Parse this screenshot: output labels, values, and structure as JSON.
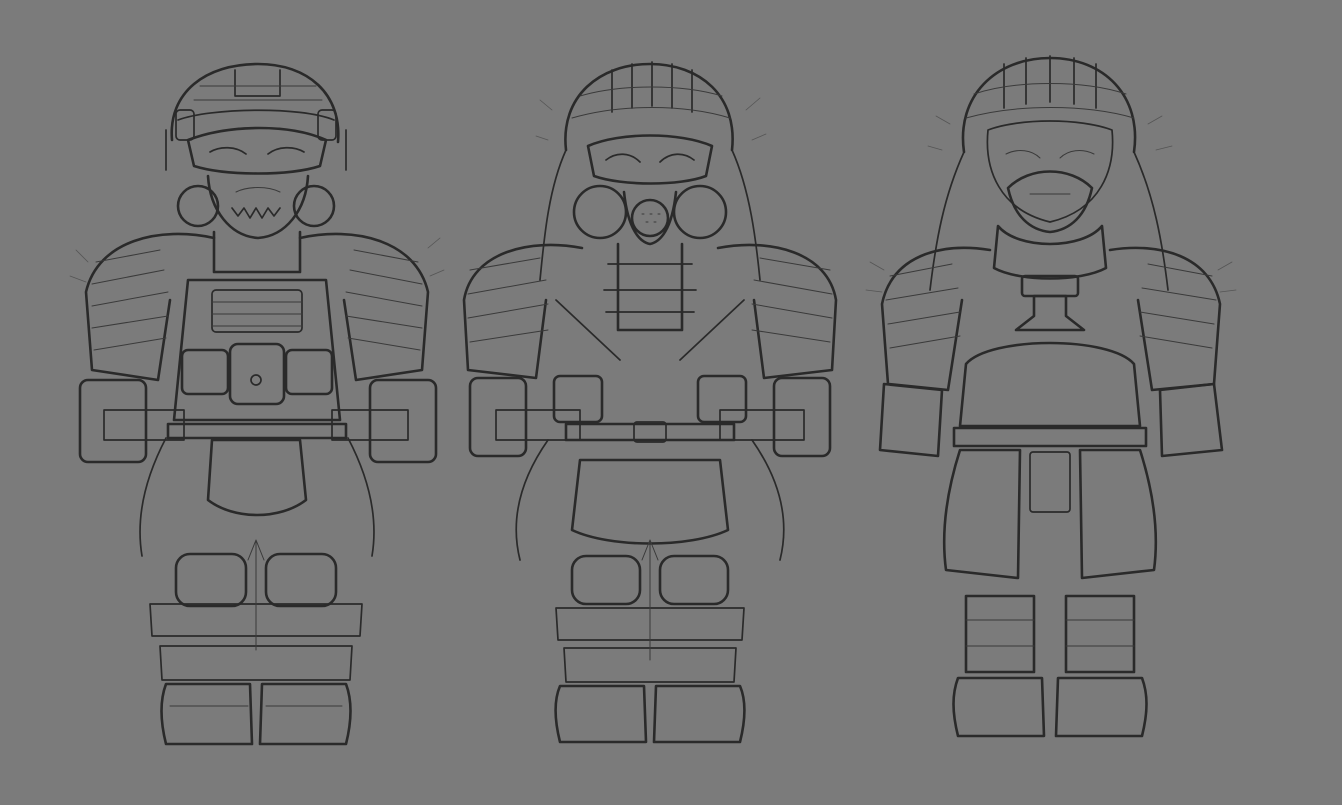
{
  "artwork": {
    "background_color": "#7b7b7b",
    "ink_color": "#2a2a2a",
    "figures": [
      {
        "name": "soldier-helmet-goggles-respirator",
        "headgear": "tactical-helmet-icon",
        "mask": "skull-respirator-icon"
      },
      {
        "name": "soldier-hooded-gas-mask",
        "headgear": "ghillie-hood-icon",
        "mask": "gas-mask-icon"
      },
      {
        "name": "soldier-hooded-half-mask",
        "headgear": "ghillie-hood-icon",
        "mask": "half-mask-icon"
      }
    ]
  }
}
